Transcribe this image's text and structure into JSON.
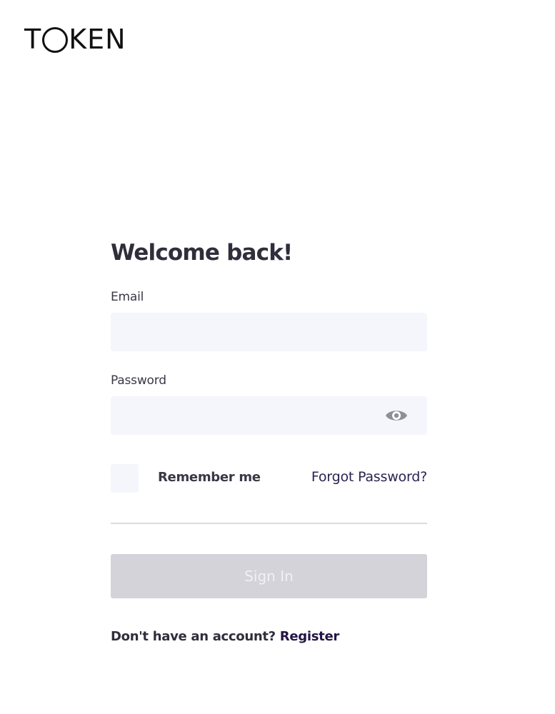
{
  "brand": {
    "logo_text": "TOKEN",
    "logo_first": "T",
    "logo_rest": "KEN"
  },
  "login": {
    "title": "Welcome back!",
    "email_label": "Email",
    "email_value": "",
    "email_placeholder": "",
    "password_label": "Password",
    "password_value": "",
    "password_placeholder": "",
    "remember_label": "Remember me",
    "remember_checked": false,
    "forgot_label": "Forgot Password?",
    "signin_label": "Sign In",
    "no_account_text": "Don't have an account?",
    "register_label": "Register"
  },
  "colors": {
    "input_bg": "#f5f6fb",
    "button_disabled_bg": "#d4d3d9",
    "link_color": "#241446",
    "text_color": "#2f2e3b"
  },
  "icons": {
    "password_toggle": "eye-icon"
  }
}
